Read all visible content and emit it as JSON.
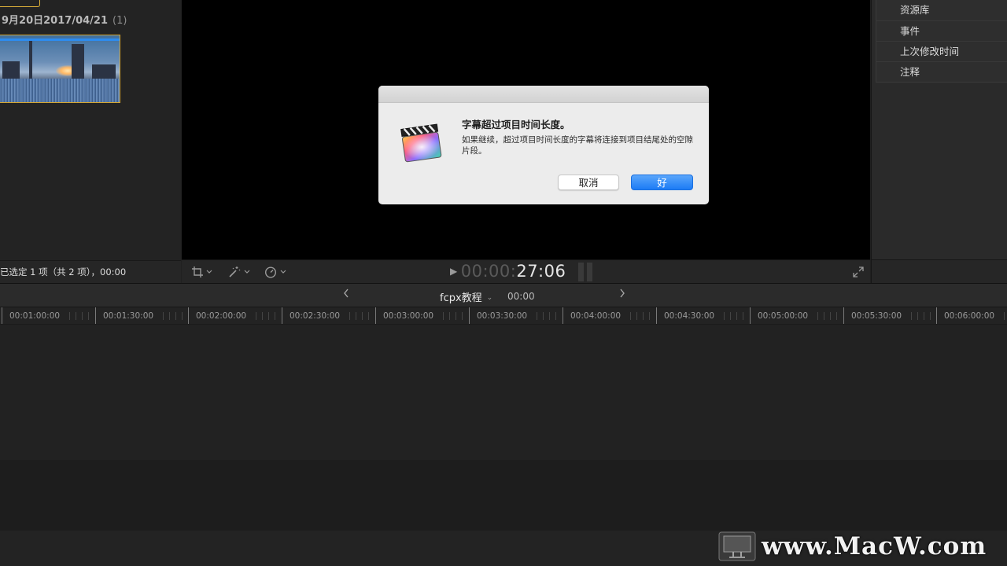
{
  "browser": {
    "group_title": "9月20日2017/04/21",
    "group_count": "(1)",
    "status": "已选定 1 项（共 2 项），00:00"
  },
  "viewer": {
    "timecode_dim": "00:00:",
    "timecode_bright": "27:06"
  },
  "inspector": {
    "menu_items": [
      "资源库",
      "事件",
      "上次修改时间",
      "注释"
    ]
  },
  "timeline": {
    "project_name": "fcpx教程",
    "duration": "00:00",
    "ruler_ticks": [
      "00:01:00:00",
      "00:01:30:00",
      "00:02:00:00",
      "00:02:30:00",
      "00:03:00:00",
      "00:03:30:00",
      "00:04:00:00",
      "00:04:30:00",
      "00:05:00:00",
      "00:05:30:00",
      "00:06:00:00"
    ]
  },
  "dialog": {
    "title": "字幕超过项目时间长度。",
    "message": "如果继续，超过项目时间长度的字幕将连接到项目结尾处的空隙片段。",
    "cancel_label": "取消",
    "ok_label": "好",
    "accent_color": "#1c7bf5"
  },
  "watermark": {
    "text": "www.MacW.com"
  }
}
